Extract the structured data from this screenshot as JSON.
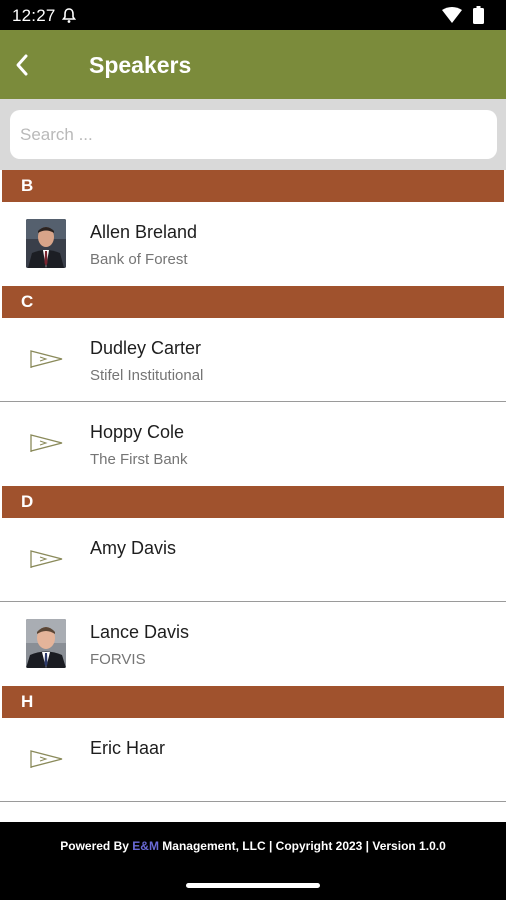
{
  "status_bar": {
    "time": "12:27"
  },
  "header": {
    "title": "Speakers"
  },
  "search": {
    "placeholder": "Search ..."
  },
  "sections": [
    {
      "letter": "B",
      "speakers": [
        {
          "name": "Allen Breland",
          "company": "Bank of Forest",
          "has_photo": true
        }
      ]
    },
    {
      "letter": "C",
      "speakers": [
        {
          "name": "Dudley Carter",
          "company": "Stifel Institutional",
          "has_photo": false
        },
        {
          "name": "Hoppy Cole",
          "company": "The First Bank",
          "has_photo": false
        }
      ]
    },
    {
      "letter": "D",
      "speakers": [
        {
          "name": "Amy Davis",
          "company": "",
          "has_photo": false
        },
        {
          "name": "Lance Davis",
          "company": "FORVIS",
          "has_photo": true
        }
      ]
    },
    {
      "letter": "H",
      "speakers": [
        {
          "name": "Eric Haar",
          "company": "",
          "has_photo": false
        }
      ]
    }
  ],
  "footer": {
    "prefix": "Powered By ",
    "brand": "E&M",
    "suffix": " Management, LLC | Copyright 2023 | Version 1.0.0"
  },
  "colors": {
    "app_bar": "#7b8b3b",
    "section_header": "#a0522d",
    "search_area": "#d9d9d9",
    "footer_bg": "#000000",
    "brand_accent": "#6a6ad6"
  },
  "icons": {
    "back": "chevron-left-icon",
    "placeholder_avatar": "pennant-icon",
    "wifi": "wifi-icon",
    "battery": "battery-icon",
    "notification": "alert-icon"
  }
}
